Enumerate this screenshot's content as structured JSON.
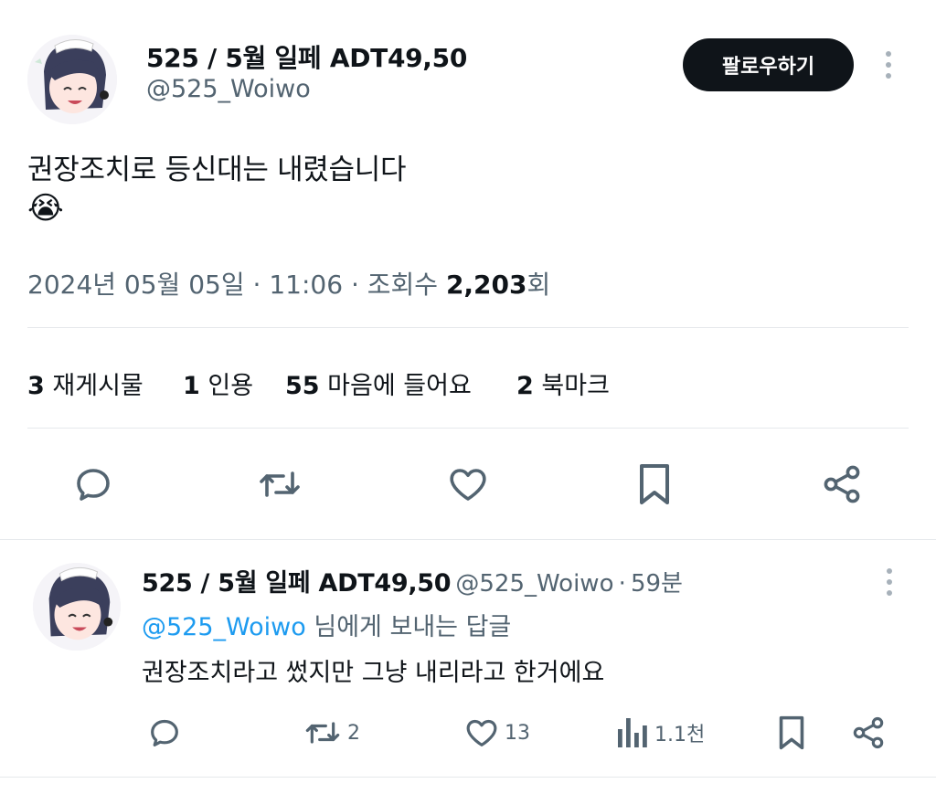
{
  "tweet": {
    "display_name": "525 / 5월 일페 ADT49,50",
    "handle": "@525_Woiwo",
    "follow_label": "팔로우하기",
    "text_line1": "권장조치로 등신대는 내렸습니다",
    "emoji": "😭",
    "date": "2024년 05월 05일",
    "sep1": "·",
    "time": "11:06",
    "sep2": "·",
    "views_label": "조회수",
    "views_count": "2,203",
    "views_suffix": "회"
  },
  "stats": {
    "reposts_count": "3",
    "reposts_label": "재게시물",
    "quotes_count": "1",
    "quotes_label": "인용",
    "likes_count": "55",
    "likes_label": "마음에 들어요",
    "bookmarks_count": "2",
    "bookmarks_label": "북마크"
  },
  "reply": {
    "display_name": "525 / 5월 일페 ADT49,50",
    "handle": "@525_Woiwo",
    "dot": "·",
    "time": "59분",
    "replying_mention": "@525_Woiwo",
    "replying_suffix": "님에게 보내는 답글",
    "text": "권장조치라고 썼지만 그냥 내리라고 한거에요",
    "retweets": "2",
    "likes": "13",
    "views": "1.1천"
  },
  "icons": {
    "reply": "reply-icon",
    "retweet": "retweet-icon",
    "like": "heart-icon",
    "bookmark": "bookmark-icon",
    "share": "share-icon",
    "views": "analytics-icon",
    "more": "more-icon"
  },
  "colors": {
    "text": "#0f1419",
    "secondary": "#536471",
    "link": "#1d9bf0",
    "button": "#0f1419",
    "divider": "#e6e9ec"
  }
}
